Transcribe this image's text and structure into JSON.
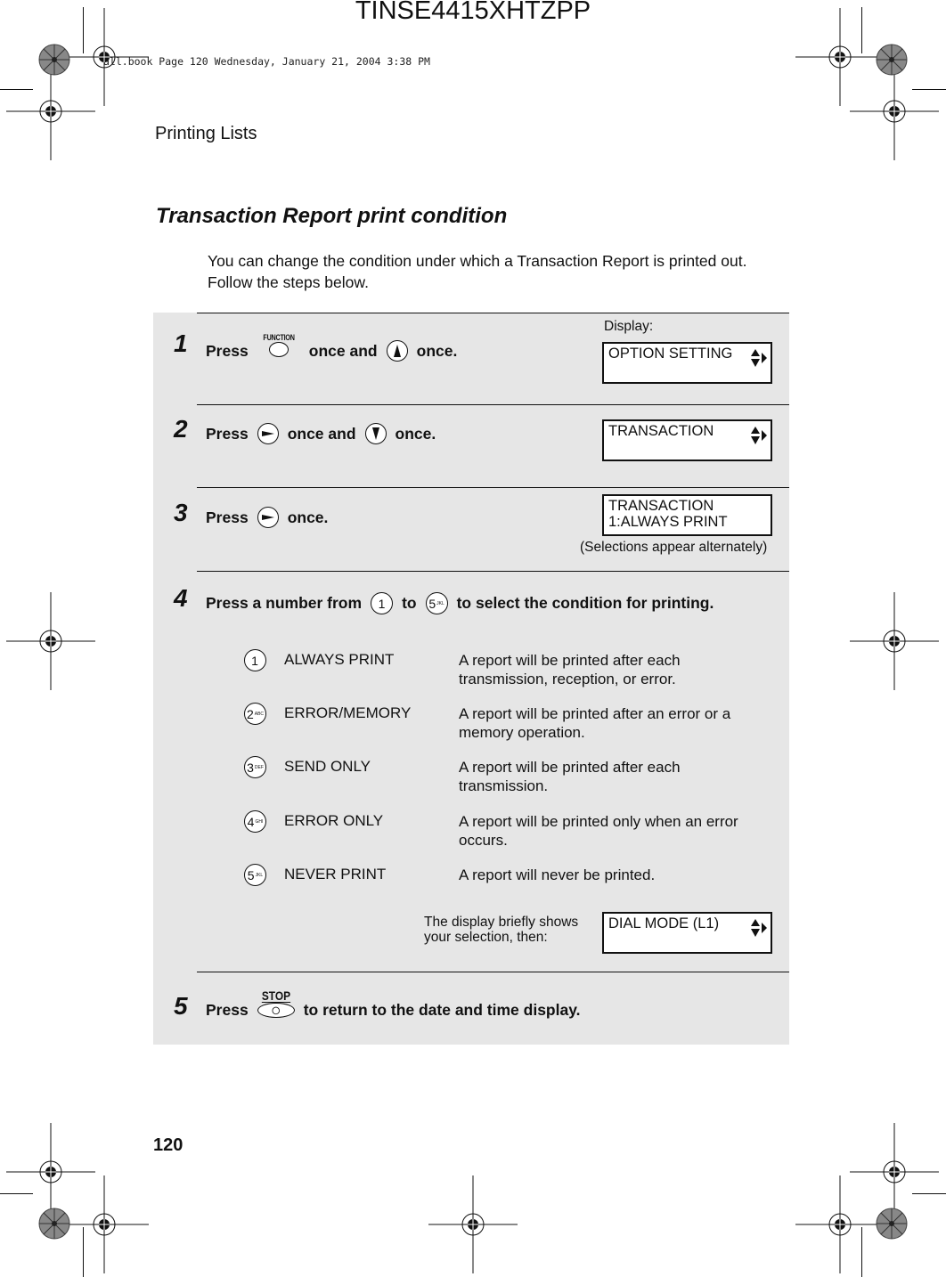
{
  "doc_id": "TINSE4415XHTZPP",
  "book_line": "all.book  Page 120  Wednesday, January 21, 2004  3:38 PM",
  "running_head": "Printing Lists",
  "page_number": "120",
  "section": {
    "title": "Transaction Report print condition",
    "intro_line1": "You can change the condition under which a Transaction Report is printed out.",
    "intro_line2": "Follow the steps below."
  },
  "display_label": "Display:",
  "steps": [
    {
      "number": "1",
      "press": "Press",
      "key1_label": "FUNCTION",
      "mid": "once and",
      "end": "once.",
      "lcd_line1": "OPTION SETTING",
      "lcd_line2": ""
    },
    {
      "number": "2",
      "press": "Press",
      "mid": "once and",
      "end": "once.",
      "lcd_line1": "TRANSACTION",
      "lcd_line2": ""
    },
    {
      "number": "3",
      "press": "Press",
      "end": "once.",
      "lcd_line1": "TRANSACTION",
      "lcd_line2": "1:ALWAYS PRINT",
      "note": "(Selections appear alternately)"
    },
    {
      "number": "4",
      "press": "Press a number from",
      "mid": "to",
      "end": "to select the condition for printing.",
      "key_from": "1",
      "key_to": "5",
      "key_to_sub": "JKL",
      "options": [
        {
          "key": "1",
          "sub": "",
          "name": "ALWAYS PRINT",
          "desc_line1": "A report will be printed after each",
          "desc_line2": "transmission, reception, or error."
        },
        {
          "key": "2",
          "sub": "ABC",
          "name": "ERROR/MEMORY",
          "desc_line1": "A report will be printed after an error or a",
          "desc_line2": "memory operation."
        },
        {
          "key": "3",
          "sub": "DEF",
          "name": "SEND ONLY",
          "desc_line1": "A report will be printed after each",
          "desc_line2": "transmission."
        },
        {
          "key": "4",
          "sub": "GHI",
          "name": "ERROR ONLY",
          "desc_line1": "A report will be printed only when an error",
          "desc_line2": "occurs."
        },
        {
          "key": "5",
          "sub": "JKL",
          "name": "NEVER PRINT",
          "desc_line1": "A report will never be printed.",
          "desc_line2": ""
        }
      ],
      "briefly_line1": "The display briefly shows",
      "briefly_line2": "your selection, then:",
      "lcd_line1": "DIAL MODE (L1)",
      "lcd_line2": ""
    },
    {
      "number": "5",
      "press": "Press",
      "key_label": "STOP",
      "end": "to return to the date and time display."
    }
  ],
  "icons": {
    "function_key": "oval-button-icon",
    "up_key": "up-arrow-key-icon",
    "down_key": "down-arrow-key-icon",
    "right_key": "right-arrow-key-icon",
    "stop_key": "stop-button-icon",
    "lcd_arrows": "up-down-right-arrows-icon"
  }
}
